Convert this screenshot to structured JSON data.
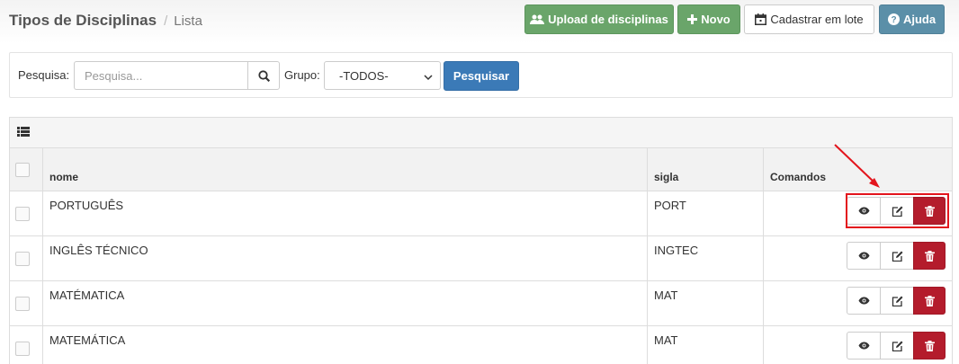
{
  "header": {
    "title": "Tipos de Disciplinas",
    "separator": "/",
    "subtitle": "Lista"
  },
  "toolbar": {
    "upload_label": "Upload de disciplinas",
    "new_label": "Novo",
    "batch_label": "Cadastrar em lote",
    "help_label": "Ajuda"
  },
  "search": {
    "label": "Pesquisa:",
    "placeholder": "Pesquisa...",
    "group_label": "Grupo:",
    "group_selected": "-TODOS-",
    "submit_label": "Pesquisar"
  },
  "table": {
    "columns": [
      "nome",
      "sigla",
      "Comandos"
    ],
    "rows": [
      {
        "nome": "PORTUGUÊS",
        "sigla": "PORT"
      },
      {
        "nome": "INGLÊS TÉCNICO",
        "sigla": "INGTEC"
      },
      {
        "nome": "MATÉMATICA",
        "sigla": "MAT"
      },
      {
        "nome": "MATEMÁTICA",
        "sigla": "MAT"
      }
    ]
  },
  "icons": {
    "upload": "users-icon",
    "new": "plus-icon",
    "batch": "calendar-icon",
    "help": "question-circle-icon",
    "search": "search-icon",
    "list": "list-icon",
    "view": "eye-icon",
    "edit": "edit-icon",
    "delete": "trash-icon"
  },
  "colors": {
    "success": "#6aa56a",
    "primary": "#3b7ab7",
    "info": "#5b8fa8",
    "danger": "#b41c2c",
    "annotation": "#e3141c"
  }
}
